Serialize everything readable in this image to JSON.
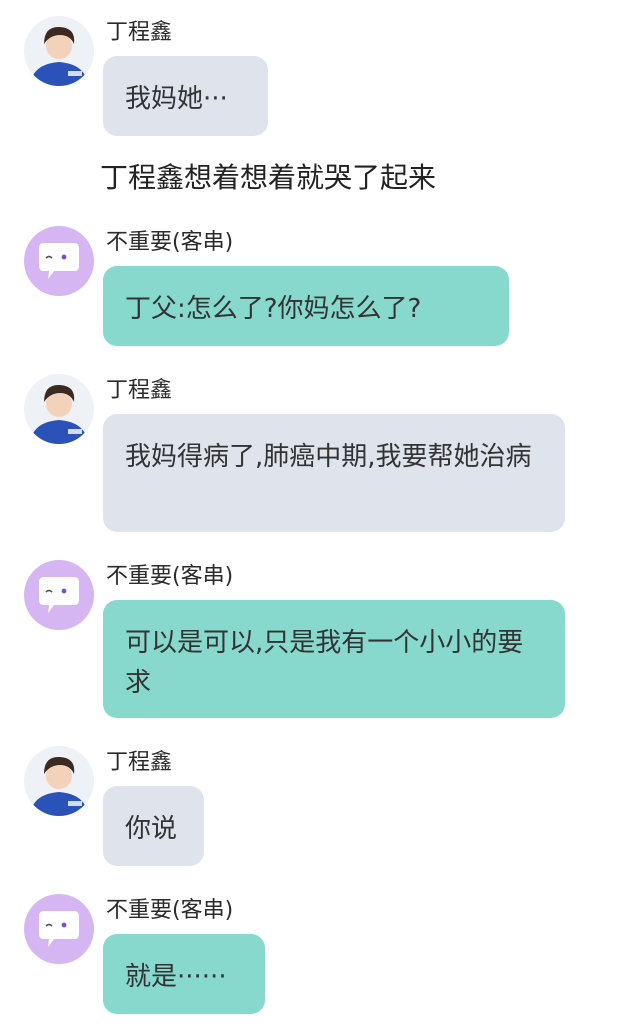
{
  "colors": {
    "grey_bubble": "#dfe4ec",
    "teal_bubble": "#87d8cd",
    "bot_avatar_bg": "#d6b6f2",
    "text": "#333333"
  },
  "messages": [
    {
      "sender": "丁程鑫",
      "avatar": "photo-avatar",
      "bubble": "grey",
      "text": "我妈她···"
    },
    {
      "sender": "不重要(客串)",
      "avatar": "chat-bubble-avatar-icon",
      "bubble": "teal",
      "text": "丁父:怎么了?你妈怎么了?"
    },
    {
      "sender": "丁程鑫",
      "avatar": "photo-avatar",
      "bubble": "grey",
      "text": "我妈得病了,肺癌中期,我要帮她治病"
    },
    {
      "sender": "不重要(客串)",
      "avatar": "chat-bubble-avatar-icon",
      "bubble": "teal",
      "text": "可以是可以,只是我有一个小小的要求"
    },
    {
      "sender": "丁程鑫",
      "avatar": "photo-avatar",
      "bubble": "grey",
      "text": "你说"
    },
    {
      "sender": "不重要(客串)",
      "avatar": "chat-bubble-avatar-icon",
      "bubble": "teal",
      "text": "就是······"
    }
  ],
  "narration": "丁程鑫想着想着就哭了起来"
}
